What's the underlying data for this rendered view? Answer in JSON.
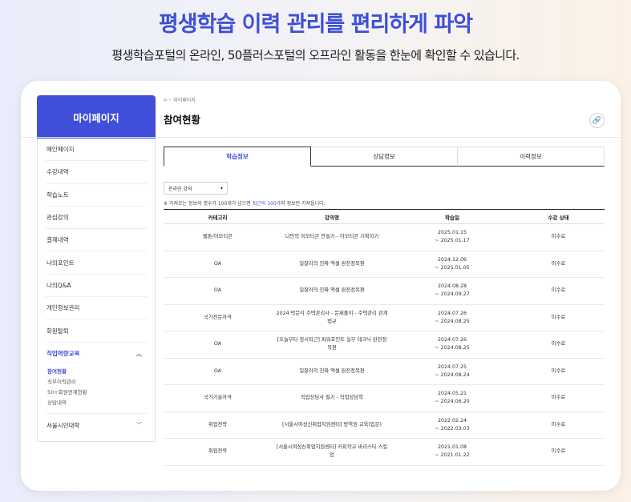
{
  "hero": {
    "title": "평생학습 이력 관리를 편리하게 파악",
    "subtitle": "평생학습포털의 온라인, 50플러스포털의 오프라인 활동을 한눈에 확인할 수 있습니다."
  },
  "sidebar": {
    "header": "마이페이지",
    "items": [
      {
        "label": "메인페이지"
      },
      {
        "label": "수강내역"
      },
      {
        "label": "학습노트"
      },
      {
        "label": "관심강의"
      },
      {
        "label": "결제내역"
      },
      {
        "label": "나의포인트"
      },
      {
        "label": "나의Q&A"
      },
      {
        "label": "개인정보관리"
      },
      {
        "label": "회원탈퇴"
      }
    ],
    "expanded": {
      "label": "직업역량교육",
      "subitems": [
        "참여현황",
        "직무이력관리",
        "50+회원연계현황",
        "상담내역"
      ]
    },
    "last": {
      "label": "서울시민대학"
    }
  },
  "breadcrumb": {
    "home_icon": "home-icon",
    "separator": "›",
    "current": "마이페이지"
  },
  "page_title": "참여현황",
  "tabs": [
    "학습정보",
    "상담정보",
    "이력정보"
  ],
  "filter": {
    "selected": "온라인 강의"
  },
  "notice": {
    "prefix": "※ 가져오는 정보의 갯수가 100개가 넘으면 ",
    "highlight": "최근의 100",
    "suffix": "가지 정보만 가져옵니다."
  },
  "table": {
    "headers": [
      "카테고리",
      "강의명",
      "학습일",
      "수강 상태"
    ],
    "rows": [
      {
        "category": "웹툰/이모티콘",
        "title": "나만의 이모티콘 만들기 - 이모티콘 기획하기",
        "date1": "2025.01.15",
        "date2": "~ 2025.01.17",
        "status": "미수료"
      },
      {
        "category": "OA",
        "title": "일잘러의 진짜 엑셀 완전정복편",
        "date1": "2024.12.06",
        "date2": "~ 2025.01.05",
        "status": "미수료"
      },
      {
        "category": "OA",
        "title": "일잘러의 진짜 엑셀 완전정복편",
        "date1": "2024.08.28",
        "date2": "~ 2024.09.27",
        "status": "미수료"
      },
      {
        "category": "국가전문자격",
        "title": "2024 박문각 주택관리사 - 문제풀이 - 주택관리 관계법규",
        "date1": "2024.07.26",
        "date2": "~ 2024.08.25",
        "status": "미수료"
      },
      {
        "category": "OA",
        "title": "[오늘부터 정시퇴근] 파워포인트 실무 테크닉 완전정복편",
        "date1": "2024.07.26",
        "date2": "~ 2024.08.25",
        "status": "미수료"
      },
      {
        "category": "OA",
        "title": "일잘러의 진짜 엑셀 완전정복편",
        "date1": "2024.07.25",
        "date2": "~ 2024.08.24",
        "status": "미수료"
      },
      {
        "category": "국가기술자격",
        "title": "직업상담사 필기 - 직업상담학",
        "date1": "2024.05.21",
        "date2": "~ 2024.06.20",
        "status": "미수료"
      },
      {
        "category": "취업전략",
        "title": "[서울시여성신취업지원센터] 방역원 교육(입문)",
        "date1": "2022.02.24",
        "date2": "~ 2022.03.03",
        "status": "미수료"
      },
      {
        "category": "취업전략",
        "title": "[서울시여성신취업지원센터] 커피학교 바리스타 스킬업",
        "date1": "2021.01.08",
        "date2": "~ 2021.01.22",
        "status": "미수료"
      }
    ]
  }
}
